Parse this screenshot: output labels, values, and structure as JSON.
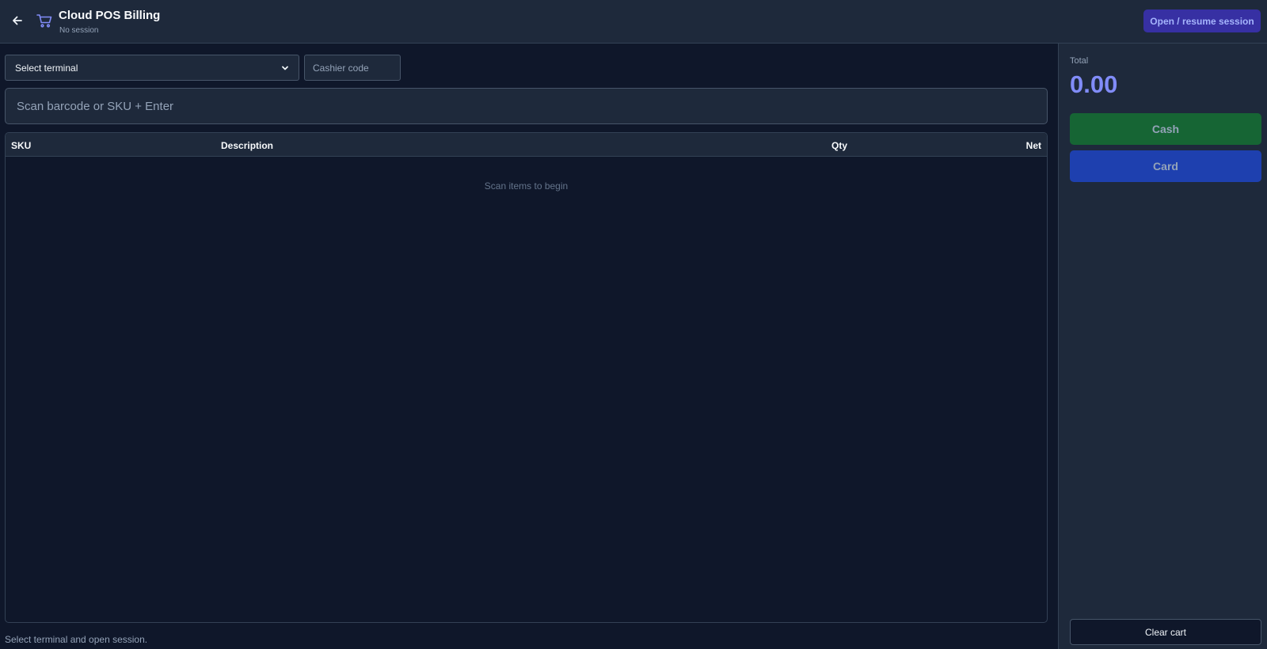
{
  "header": {
    "back_icon": "arrow-left-icon",
    "app_icon": "shopping-cart-icon",
    "title": "Cloud POS Billing",
    "subtitle": "No session",
    "session_button": "Open / resume session"
  },
  "controls": {
    "terminal_select": {
      "selected": "Select terminal",
      "icon": "chevron-down-icon"
    },
    "cashier_placeholder": "Cashier code",
    "scan_placeholder": "Scan barcode or SKU + Enter"
  },
  "table": {
    "columns": [
      "SKU",
      "Description",
      "Qty",
      "Net"
    ],
    "rows": [],
    "empty_message": "Scan items to begin"
  },
  "status_text": "Select terminal and open session.",
  "summary": {
    "total_label": "Total",
    "total_value": "0.00",
    "cash_button": "Cash",
    "card_button": "Card",
    "clear_button": "Clear cart"
  },
  "colors": {
    "background": "#0f172a",
    "panel": "#1e293b",
    "accent": "#818cf8",
    "session_button": "#3730a3",
    "cash": "#166534",
    "card": "#1e40af"
  }
}
